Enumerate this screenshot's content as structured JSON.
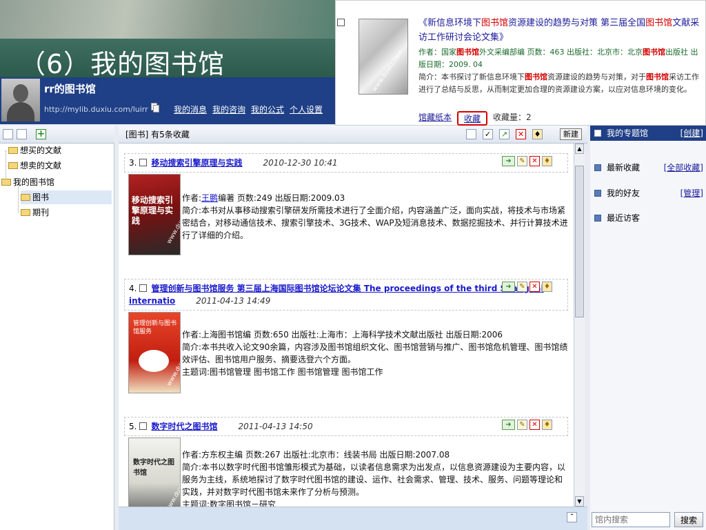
{
  "slide": {
    "title": "（6）我的图书馆"
  },
  "header": {
    "lib_name": "rr的图书馆",
    "url": "http://mylib.duxiu.com/luirr",
    "nav": [
      "我的消息",
      "我的咨询",
      "我的公式",
      "个人设置"
    ]
  },
  "popup": {
    "title_pre": "《新信息环境下",
    "title_hl1": "图书馆",
    "title_mid": "资源建设的趋势与对策 第三届全国",
    "title_hl2": "图书馆",
    "title_post": "文献采访工作研讨会论文集》",
    "author_pre": "作者：国家",
    "author_hl": "图书馆",
    "author_post": "外文采编部编 页数：463 出版社：北京市：北京",
    "author_hl2": "图书馆",
    "author_tail": "出版社 出版日期：2009. 04",
    "desc_pre": "简介：本书探讨了新信息环境下",
    "desc_hl": "图书馆",
    "desc_mid": "资源建设的趋势与对策，对于",
    "desc_hl2": "图书馆",
    "desc_post": "采访工作进行了总结与反思，从而制定更加合理的资源建设方案，以应对信息环境的变化。",
    "links": {
      "paper": "馆藏纸本",
      "fav": "收藏",
      "count": "收藏量：2"
    },
    "cover_watermark": "www.duxiu.com"
  },
  "tree": {
    "items": [
      "想买的文献",
      "想卖的文献",
      "我的图书馆",
      "图书",
      "期刊"
    ]
  },
  "main": {
    "label": "[图书]  有5条收藏",
    "new_button": "新建",
    "entries": [
      {
        "num": "3.",
        "title": "移动搜索引擎原理与实践",
        "date": "2010-12-30 10:41",
        "author_pre": "作者:",
        "author_link": "王鹏",
        "author_post": "编著  页数:249  出版日期:2009.03",
        "desc": "简介:本书对从事移动搜索引擎研发所需技术进行了全面介绍，内容涵盖广泛，面向实战，将技术与市场紧密结合，对移动通信技术、搜索引擎技术、3G技术、WAP及短消息技术、数据挖掘技术、并行计算技术进行了详细的介绍。",
        "cover_text": "移动搜索引擎原理与实践"
      },
      {
        "num": "4.",
        "title": "管理创新与图书馆服务  第三届上海国际图书馆论坛论文集  The proceedings of the third Shanghai internatio",
        "date": "2011-04-13 14:49",
        "author": "作者:上海图书馆编 页数:650 出版社:上海市：上海科学技术文献出版社 出版日期:2006",
        "desc": "简介:本书共收入论文90余篇，内容涉及图书馆组织文化、图书馆营销与推广、图书馆危机管理、图书馆绩效评估、图书馆用户服务、摘要选登六个方面。",
        "subject": "主题词:图书馆管理  图书馆工作  图书馆管理  图书馆工作",
        "cover_text": "管理创新与图书馆服务"
      },
      {
        "num": "5.",
        "title": "数字时代之图书馆",
        "date": "2011-04-13 14:50",
        "author": "作者:方东权主编 页数:267 出版社:北京市：线装书局 出版日期:2007.08",
        "desc": "简介:本书以数字时代图书馆雏形模式为基础，以读者信息需求为出发点，以信息资源建设为主要内容，以服务为主线，系统地探讨了数字时代图书馆的建设、运作、社会需求、管理、技术、服务、问题等理论和实践，并对数字时代图书馆未来作了分析与预测。",
        "subject": "主题词:数字图书馆－研究",
        "cover_text": "数字时代之图书馆"
      }
    ]
  },
  "right": {
    "boxes": [
      {
        "title": "我的专题馆",
        "link": "[创建]"
      },
      {
        "title": "最新收藏",
        "link": "[全部收藏]"
      },
      {
        "title": "我的好友",
        "link": "[管理]"
      },
      {
        "title": "最近访客",
        "link": ""
      }
    ],
    "search_placeholder": "馆内搜索",
    "search_button": "搜索"
  },
  "colors": {
    "header_blue": "#1f3f86",
    "highlight_red": "#d40000",
    "link_blue": "#1a1acc"
  }
}
